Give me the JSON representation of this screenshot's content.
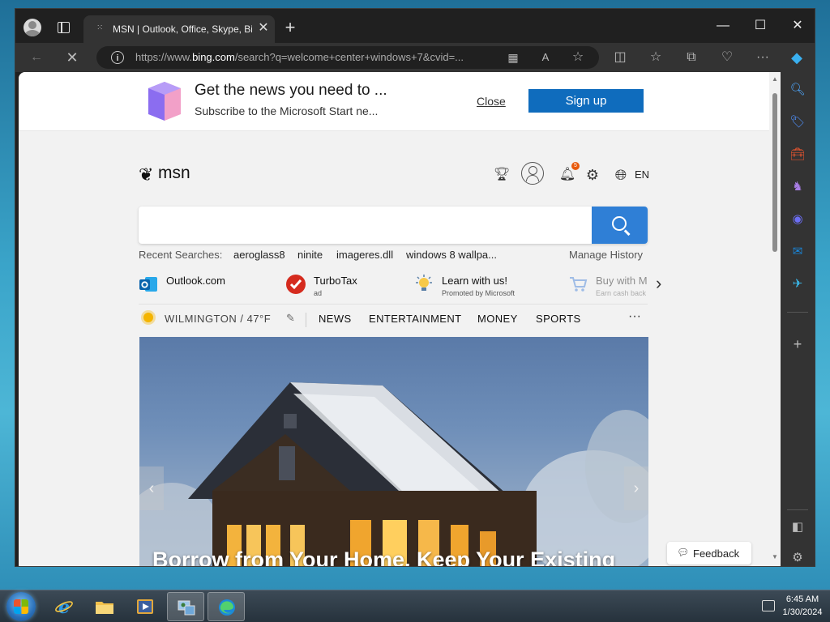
{
  "browser": {
    "tab_title": "MSN | Outlook, Office, Skype, Bing",
    "tab_close": "✕",
    "new_tab": "+",
    "url_prefix": "https://www.",
    "url_host": "bing.com",
    "url_rest": "/search?q=welcome+center+windows+7&cvid=...",
    "window_controls": {
      "minimize": "—",
      "maximize": "☐",
      "close": "✕"
    }
  },
  "banner": {
    "title": "Get the news you need to ...",
    "subtitle": "Subscribe to the Microsoft Start ne...",
    "close_label": "Close",
    "signup_label": "Sign up"
  },
  "msn": {
    "logo_text": "msn",
    "language": "EN",
    "notification_count": "5",
    "search_placeholder": "",
    "recent_label": "Recent Searches:",
    "recent_searches": [
      "aeroglass8",
      "ninite",
      "imageres.dll",
      "windows 8 wallpa..."
    ],
    "manage_history": "Manage History"
  },
  "quick_links": [
    {
      "label": "Outlook.com",
      "sub": ""
    },
    {
      "label": "TurboTax",
      "sub": "ad"
    },
    {
      "label": "Learn with us!",
      "sub": "Promoted by Microsoft"
    },
    {
      "label": "Buy with M",
      "sub": "Earn cash back"
    }
  ],
  "nav": {
    "weather": "WILMINGTON / 47°F",
    "items": [
      "NEWS",
      "ENTERTAINMENT",
      "MONEY",
      "SPORTS"
    ],
    "more": "···"
  },
  "hero": {
    "caption": "Borrow from Your Home, Keep Your Existing"
  },
  "feedback_label": "Feedback",
  "taskbar": {
    "time": "6:45 AM",
    "date": "1/30/2024"
  },
  "colors": {
    "accent": "#0f6cbd",
    "search_button": "#2f7fd6",
    "browser_chrome": "#202020"
  }
}
